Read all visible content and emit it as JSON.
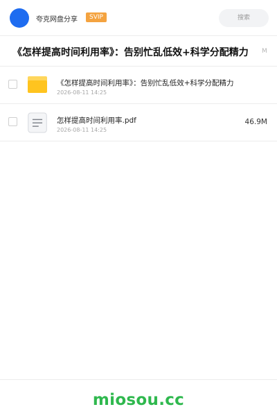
{
  "header": {
    "app_name": "夸克网盘分享",
    "badge": "SVIP",
    "search_placeholder": "搜索"
  },
  "share": {
    "title": "《怎样提高时间利用率》：告别忙乱低效+科学分配精力",
    "total_size": "M"
  },
  "files": [
    {
      "type": "folder-icon",
      "name": "《怎样提高时间利用率》：告别忙乱低效+科学分配精力",
      "date": "2026-08-11 14:25",
      "size": ""
    },
    {
      "type": "document-icon",
      "name": "怎样提高时间利用率.pdf",
      "date": "2026-08-11 14:25",
      "size": "46.9M"
    }
  ],
  "footer": {
    "logo_text": "miosou.cc"
  },
  "colors": {
    "accent": "#1e6cf0",
    "svip_badge": "#f4a340",
    "folder": "#ffc41f",
    "footer_logo": "#2fb84e"
  }
}
